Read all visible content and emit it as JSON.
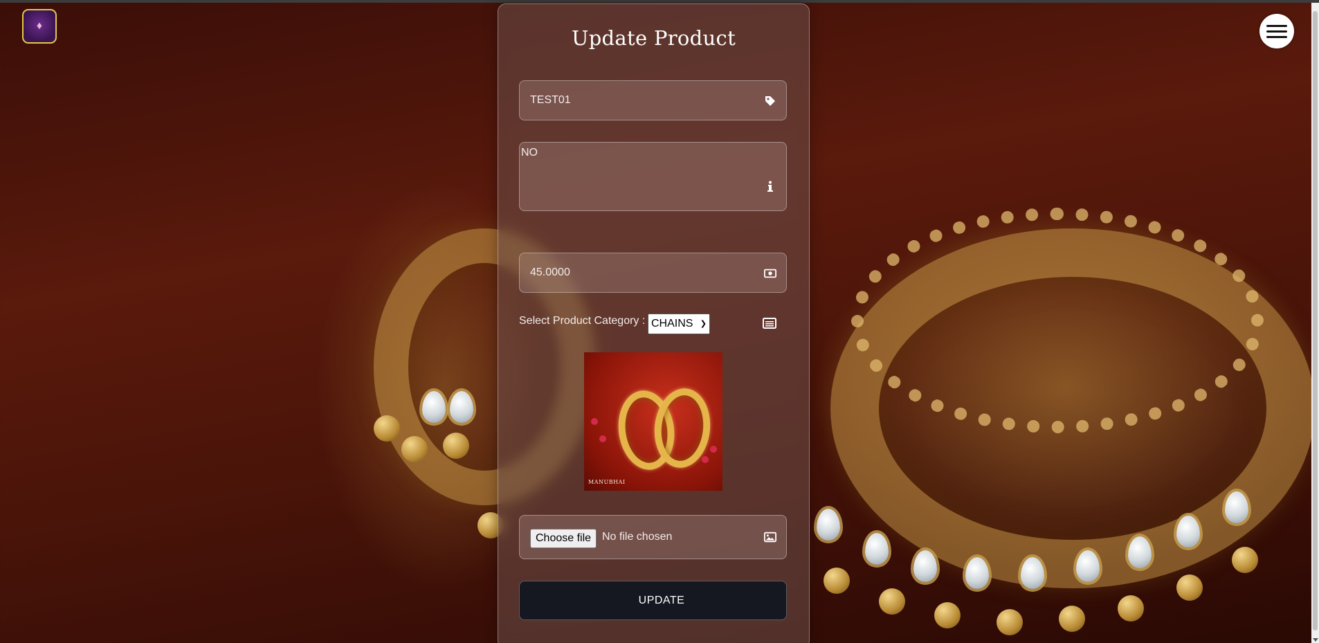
{
  "header": {
    "logo_icon": "logo-icon",
    "menu_icon": "hamburger-menu-icon"
  },
  "form": {
    "title": "Update Product",
    "product_name": {
      "value": "TEST01",
      "icon": "tag-icon"
    },
    "description": {
      "value": "NO",
      "icon": "info-icon"
    },
    "price": {
      "value": "45.0000",
      "icon": "money-icon"
    },
    "category": {
      "label": "Select Product Category :",
      "selected": "CHAINS",
      "icon": "list-icon"
    },
    "image_preview": {
      "brand_text": "MANUBHAI"
    },
    "file": {
      "button_label": "Choose file",
      "status": "No file chosen",
      "icon": "image-icon"
    },
    "submit_label": "UPDATE"
  },
  "colors": {
    "card_bg": "#6e504b",
    "button_bg": "#151821",
    "logo_border": "#e6c84a"
  }
}
